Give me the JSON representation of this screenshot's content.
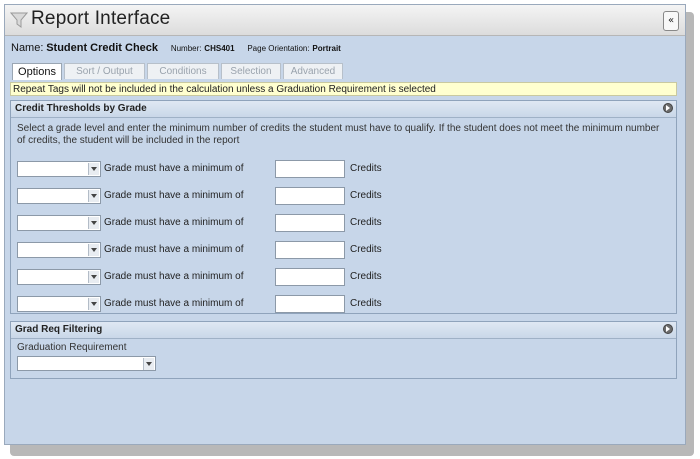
{
  "window": {
    "title": "Report Interface",
    "collapse_label": "«"
  },
  "report": {
    "name_label": "Name:",
    "name_value": "Student Credit Check",
    "number_label": "Number:",
    "number_value": "CHS401",
    "orientation_label": "Page Orientation:",
    "orientation_value": "Portrait"
  },
  "tabs": [
    {
      "label": "Options",
      "active": true
    },
    {
      "label": "Sort / Output",
      "active": false
    },
    {
      "label": "Conditions",
      "active": false
    },
    {
      "label": "Selection",
      "active": false
    },
    {
      "label": "Advanced",
      "active": false
    }
  ],
  "notice": "Repeat Tags will not be included in the calculation unless a Graduation Requirement is selected",
  "credit_thresholds": {
    "header": "Credit Thresholds by Grade",
    "description": "Select a grade level and enter the minimum number of credits the student must have to qualify. If the student does not meet the minimum number of credits, the student will be included in the report",
    "rows": [
      {
        "grade": "",
        "text": "Grade must have a minimum of",
        "credits": "",
        "unit": "Credits"
      },
      {
        "grade": "",
        "text": "Grade must have a minimum of",
        "credits": "",
        "unit": "Credits"
      },
      {
        "grade": "",
        "text": "Grade must have a minimum of",
        "credits": "",
        "unit": "Credits"
      },
      {
        "grade": "",
        "text": "Grade must have a minimum of",
        "credits": "",
        "unit": "Credits"
      },
      {
        "grade": "",
        "text": "Grade must have a minimum of",
        "credits": "",
        "unit": "Credits"
      },
      {
        "grade": "",
        "text": "Grade must have a minimum of",
        "credits": "",
        "unit": "Credits"
      }
    ]
  },
  "grad_req": {
    "header": "Grad Req Filtering",
    "label": "Graduation Requirement",
    "selected": ""
  },
  "icons": {
    "title": "funnel-icon",
    "collapse": "double-chevron-left-icon",
    "panel_toggle": "circle-arrow-icon",
    "dropdown": "chevron-down-icon"
  }
}
